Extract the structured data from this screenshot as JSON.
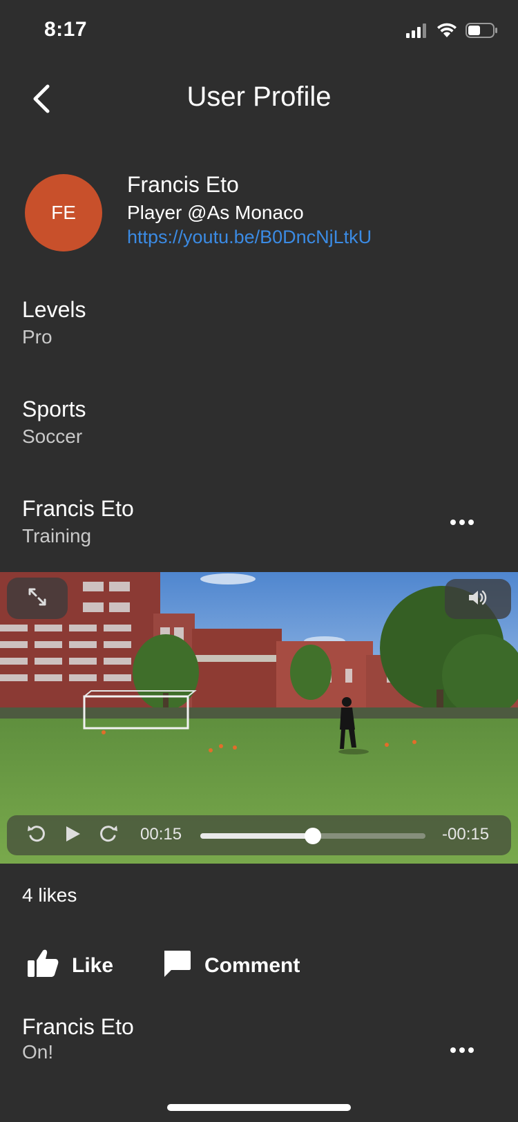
{
  "status_bar": {
    "time": "8:17",
    "signal_icon": "cellular-signal-icon",
    "wifi_icon": "wifi-icon",
    "battery_icon": "battery-icon",
    "battery_level": 0.5
  },
  "nav": {
    "back_icon": "chevron-left-icon",
    "title": "User Profile"
  },
  "profile": {
    "initials": "FE",
    "avatar_color": "#c8502b",
    "name": "Francis Eto",
    "role": "Player @As Monaco",
    "link": "https://youtu.be/B0DncNjLtkU"
  },
  "details": [
    {
      "label": "Levels",
      "value": "Pro"
    },
    {
      "label": "Sports",
      "value": "Soccer"
    }
  ],
  "post": {
    "author": "Francis Eto",
    "subtitle": "Training",
    "more_icon": "more-horizontal-icon",
    "video": {
      "elapsed": "00:15",
      "remaining": "-00:15",
      "progress": 0.5,
      "expand_icon": "expand-icon",
      "volume_icon": "volume-icon",
      "rewind_icon": "replay-icon",
      "play_icon": "play-icon",
      "forward_icon": "forward-icon"
    },
    "likes_text": "4 likes",
    "like_label": "Like",
    "like_icon": "thumbs-up-icon",
    "comment_label": "Comment",
    "comment_icon": "comment-icon"
  },
  "comment": {
    "author": "Francis Eto",
    "text": "On!",
    "more_icon": "more-horizontal-icon"
  },
  "colors": {
    "background": "#2e2e2e",
    "link": "#3b8be4",
    "secondary_text": "#c9c9c9"
  }
}
